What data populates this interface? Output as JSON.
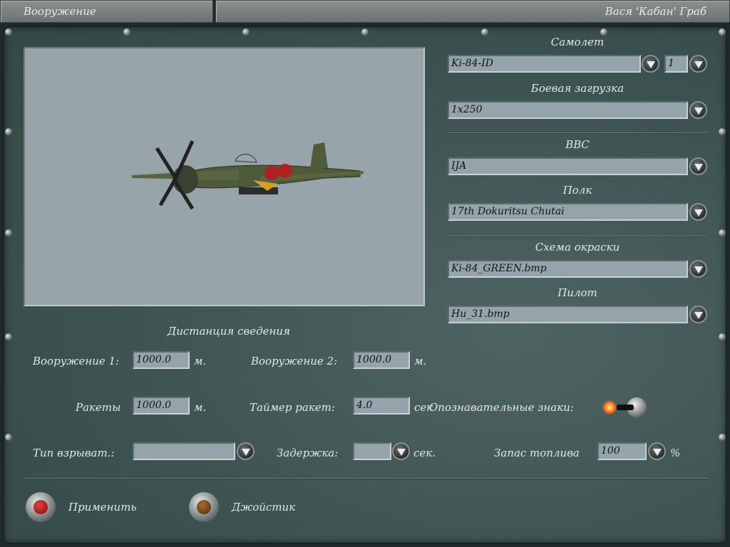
{
  "header": {
    "screen_title": "Вооружение",
    "pilot_name": "Вася 'Кабан' Граб"
  },
  "aircraft": {
    "label": "Самолет",
    "value": "Ki-84-ID",
    "count": "1"
  },
  "loadout": {
    "label": "Боевая загрузка",
    "value": "1x250"
  },
  "air_force": {
    "label": "ВВС",
    "value": "IJA"
  },
  "regiment": {
    "label": "Полк",
    "value": "17th Dokuritsu Chutai"
  },
  "skin": {
    "label": "Схема окраски",
    "value": "Ki-84_GREEN.bmp"
  },
  "pilot": {
    "label": "Пилот",
    "value": "Hu_31.bmp"
  },
  "convergence": {
    "title": "Дистанция сведения",
    "weapon1": {
      "label": "Вооружение 1:",
      "value": "1000.0",
      "unit": "м."
    },
    "weapon2": {
      "label": "Вооружение 2:",
      "value": "1000.0",
      "unit": "м."
    },
    "rockets": {
      "label": "Ракеты",
      "value": "1000.0",
      "unit": "м."
    },
    "rocket_timer": {
      "label": "Таймер ракет:",
      "value": "4.0",
      "unit": "сек"
    }
  },
  "markings": {
    "label": "Опознавательные знаки:",
    "enabled": true
  },
  "fuze": {
    "label": "Тип взрыват.:",
    "value": ""
  },
  "delay": {
    "label": "Задержка:",
    "value": "",
    "unit": "сек."
  },
  "fuel": {
    "label": "Запас топлива",
    "value": "100",
    "unit": "%"
  },
  "buttons": {
    "apply": "Применить",
    "joystick": "Джойстик"
  },
  "colors": {
    "panel": "#3c5250",
    "field": "#95a4aa",
    "apply_light": "#b01010",
    "joystick_light": "#6a3a10"
  }
}
